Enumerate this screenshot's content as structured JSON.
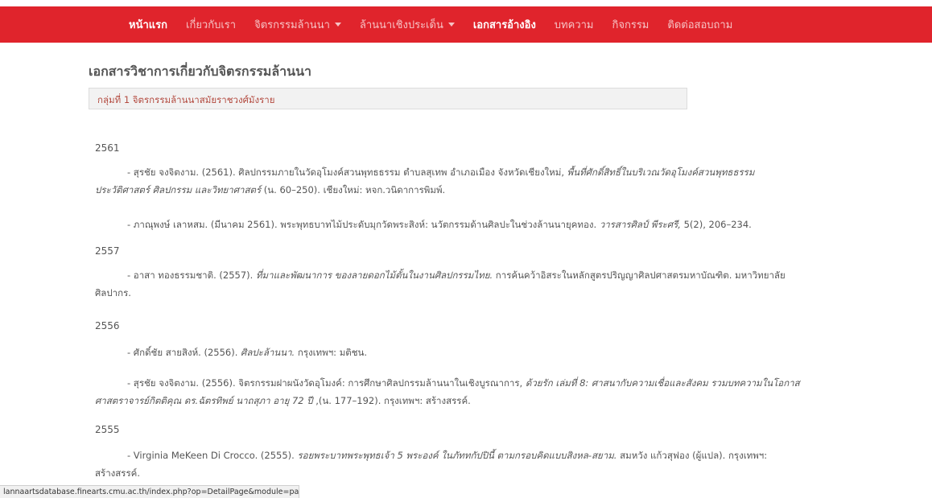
{
  "nav": {
    "items": [
      {
        "label": "หน้าแรก",
        "bold": true,
        "caret": false
      },
      {
        "label": "เกี่ยวกับเรา",
        "bold": false,
        "caret": false
      },
      {
        "label": "จิตรกรรมล้านนา",
        "bold": false,
        "caret": true
      },
      {
        "label": "ล้านนาเชิงประเด็น",
        "bold": false,
        "caret": true
      },
      {
        "label": "เอกสารอ้างอิง",
        "bold": true,
        "caret": false
      },
      {
        "label": "บทความ",
        "bold": false,
        "caret": false
      },
      {
        "label": "กิจกรรม",
        "bold": false,
        "caret": false
      },
      {
        "label": "ติดต่อสอบถาม",
        "bold": false,
        "caret": false
      }
    ],
    "background": "#e0242c"
  },
  "page": {
    "title": "เอกสารวิชาการเกี่ยวกับจิตรกรรมล้านนา",
    "group_heading": "กลุ่มที่ 1 จิตรกรรมล้านนาสมัยราชวงศ์มังราย"
  },
  "years": [
    "2561",
    "2557",
    "2556",
    "2555"
  ],
  "entries": [
    {
      "l1a": "- สุรชัย จงจิตงาม. (2561). ศิลปกรรมภายในวัดอุโมงค์สวนพุทธธรรม ตำบลสุเทพ อำเภอเมือง จังหวัดเชียงใหม่, ",
      "l1i": "พื้นที่ศักดิ์สิทธิ์ในบริเวณวัดอุโมงค์สวนพุทธธรรม",
      "l2i": "ประวัติศาสตร์ ศิลปกรรม และวิทยาศาสตร์",
      "l2a": " (น. 60–250). เชียงใหม่: หจก.วนิดาการพิมพ์."
    },
    {
      "l1a": "- ภาณุพงษ์ เลาหสม. (มีนาคม 2561). พระพุทธบาทไม้ประดับมุกวัดพระสิงห์: นวัตกรรมด้านศิลปะในช่วงล้านนายุคทอง. ",
      "l1i": "วารสารศิลป์ พีระศรี,",
      "l1b": " 5(2), 206–234."
    },
    {
      "l1a": "- อาสา ทองธรรมชาติ. (2557). ",
      "l1i": "ที่มาและพัฒนาการ ของลายดอกไม้ตั้นในงานศิลปกรรมไทย.",
      "l1b": " การค้นคว้าอิสระในหลักสูตรปริญญาศิลปศาสตรมหาบัณฑิต. มหาวิทยาลัย",
      "l2a": "ศิลปากร."
    },
    {
      "l1a": "- ศักดิ์ชัย สายสิงห์. (2556). ",
      "l1i": "ศิลปะล้านนา.",
      "l1b": " กรุงเทพฯ: มติชน."
    },
    {
      "l1a": "- สุรชัย จงจิตงาม. (2556). จิตรกรรมฝาผนังวัดอุโมงค์: การศึกษาศิลปกรรมล้านนาในเชิงบูรณาการ, ",
      "l1i": "ด้วยรัก เล่มที่ 8: ศาสนากับความเชื่อและสังคม รวมบทความในโอกาส",
      "l2i": "ศาสตราจารย์กิตติคุณ ดร.ฉัตรทิพย์ นาถสุภา อายุ 72 ปี",
      "l2a": " ,(น. 177–192). กรุงเทพฯ: สร้างสรรค์."
    },
    {
      "l1a": "- Virginia MeKeen Di Crocco. (2555). ",
      "l1i": "รอยพระบาทพระพุทธเจ้า 5 พระองค์ ในภัททกัปปินี้ ตามกรอบคิดแบบสิงหล-สยาม.",
      "l1b": " สมหวัง แก้วสุฟอง (ผู้แปล). กรุงเทพฯ:",
      "l2a": "สร้างสรรค์."
    }
  ],
  "status_url": "lannaartsdatabase.finearts.cmu.ac.th/index.php?op=DetailPage&module=page&IDPag..."
}
